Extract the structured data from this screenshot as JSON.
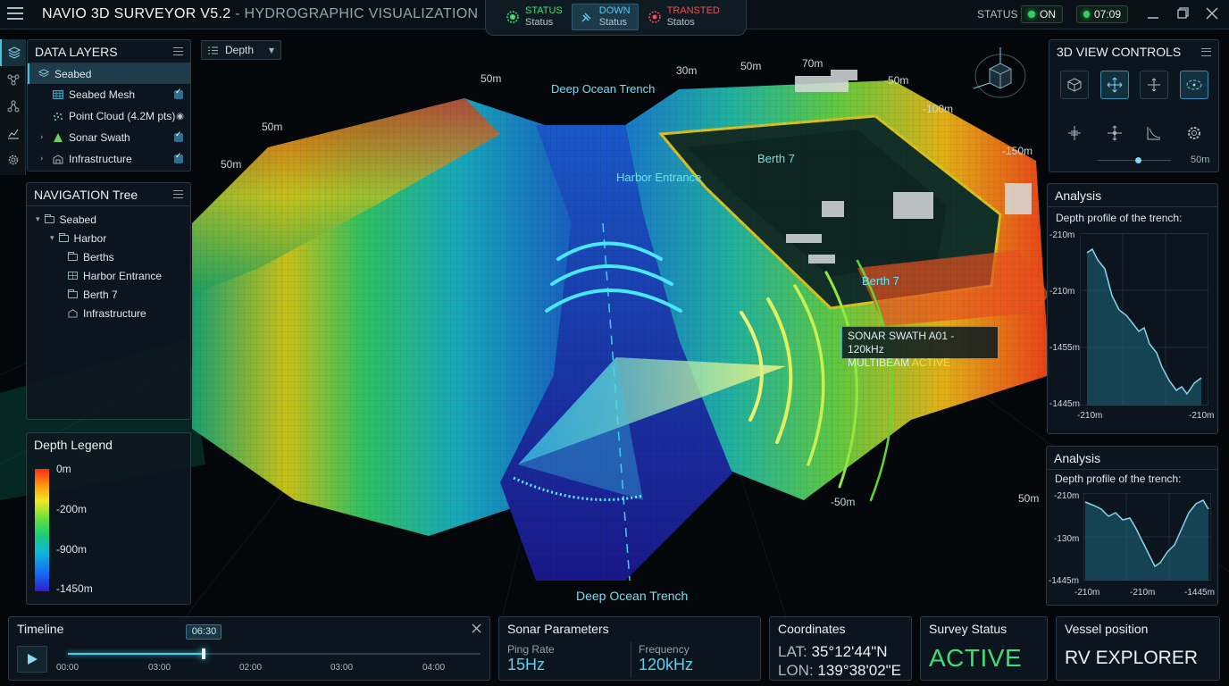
{
  "app": {
    "title": "NAVIO 3D SURVEYOR V5.2",
    "subtitle": "- HYDROGRAPHIC VISUALIZATION",
    "status_tabs": [
      {
        "title": "STATUS",
        "sub": "Status",
        "color": "#40e070"
      },
      {
        "title": "DOWN",
        "sub": "Status",
        "color": "#58c8f0"
      },
      {
        "title": "TRANSTED",
        "sub": "Statos",
        "color": "#f05050"
      }
    ],
    "status_label": "STATUS",
    "toggle_label": "ON",
    "clock": "07:09"
  },
  "data_layers": {
    "title": "DATA LAYERS",
    "selected_root": "Seabed",
    "items": [
      {
        "label": "Seabed Mesh",
        "control": "checked"
      },
      {
        "label": "Point Cloud (4.2M pts)",
        "control": "visible"
      },
      {
        "label": "Sonar Swath",
        "control": "checked"
      },
      {
        "label": "Infrastructure",
        "control": "checked"
      }
    ]
  },
  "view_dropdown": {
    "label": "Depth"
  },
  "nav_tree": {
    "title": "NAVIGATION Tree",
    "items": [
      "Seabed",
      "Harbor",
      "Berths",
      "Harbor Entrance",
      "Berth 7",
      "Infrastructure"
    ]
  },
  "legend": {
    "title": "Depth Legend",
    "labels": [
      "0m",
      "-200m",
      "-900m",
      "-1450m"
    ]
  },
  "view_controls": {
    "title": "3D VIEW CONTROLS",
    "zoom_label": "50m",
    "tools": [
      "cube-icon",
      "move-icon",
      "pan-icon",
      "orbit-icon",
      "height-icon",
      "center-icon",
      "slope-icon",
      "settings-icon"
    ],
    "slider_value": 0.55
  },
  "analysis_top": {
    "title": "Analysis",
    "caption": "Depth profile of the trench:",
    "y_labels": [
      "-210m",
      "-210m",
      "-1455m",
      "-1445m"
    ],
    "x_labels": [
      "-210m",
      "-210m"
    ]
  },
  "analysis_bottom": {
    "title": "Analysis",
    "caption": "Depth profile of the trench:",
    "y_labels": [
      "-210m",
      "-130m",
      "-1445m"
    ],
    "x_labels": [
      "-210m",
      "-210m",
      "-1445m"
    ]
  },
  "scene": {
    "labels": {
      "deep_top": "Deep Ocean Trench",
      "deep_bottom": "Deep Ocean Trench",
      "harbor_entrance": "Harbor Entrance",
      "berth_7_top": "Berth 7",
      "berth_7_bottom": "Berth 7",
      "sonar_line1": "SONAR SWATH A01 - 120kHz",
      "sonar_line2_prefix": "MULTIBEAM",
      "sonar_line2_status": "ACTIVE"
    },
    "depth_marks": [
      "50m",
      "50m",
      "50m",
      "30m",
      "50m",
      "70m",
      "-50m",
      "-100m",
      "-150m",
      "-50m",
      "50m"
    ]
  },
  "timeline": {
    "title": "Timeline",
    "current": "06:30",
    "ticks": [
      "00:00",
      "03:00",
      "02:00",
      "03:00",
      "04:00"
    ],
    "progress": 0.33
  },
  "sonar_params": {
    "title": "Sonar Parameters",
    "ping_label": "Ping Rate",
    "ping_value": "15Hz",
    "freq_label": "Frequency",
    "freq_value": "120kHz"
  },
  "coordinates": {
    "title": "Coordinates",
    "lat_label": "LAT:",
    "lat": "35°12'44\"N",
    "lon_label": "LON:",
    "lon": "139°38'02\"E"
  },
  "survey_status": {
    "title": "Survey Status",
    "value": "ACTIVE"
  },
  "vessel": {
    "title": "Vessel position",
    "value": "RV EXPLORER"
  }
}
